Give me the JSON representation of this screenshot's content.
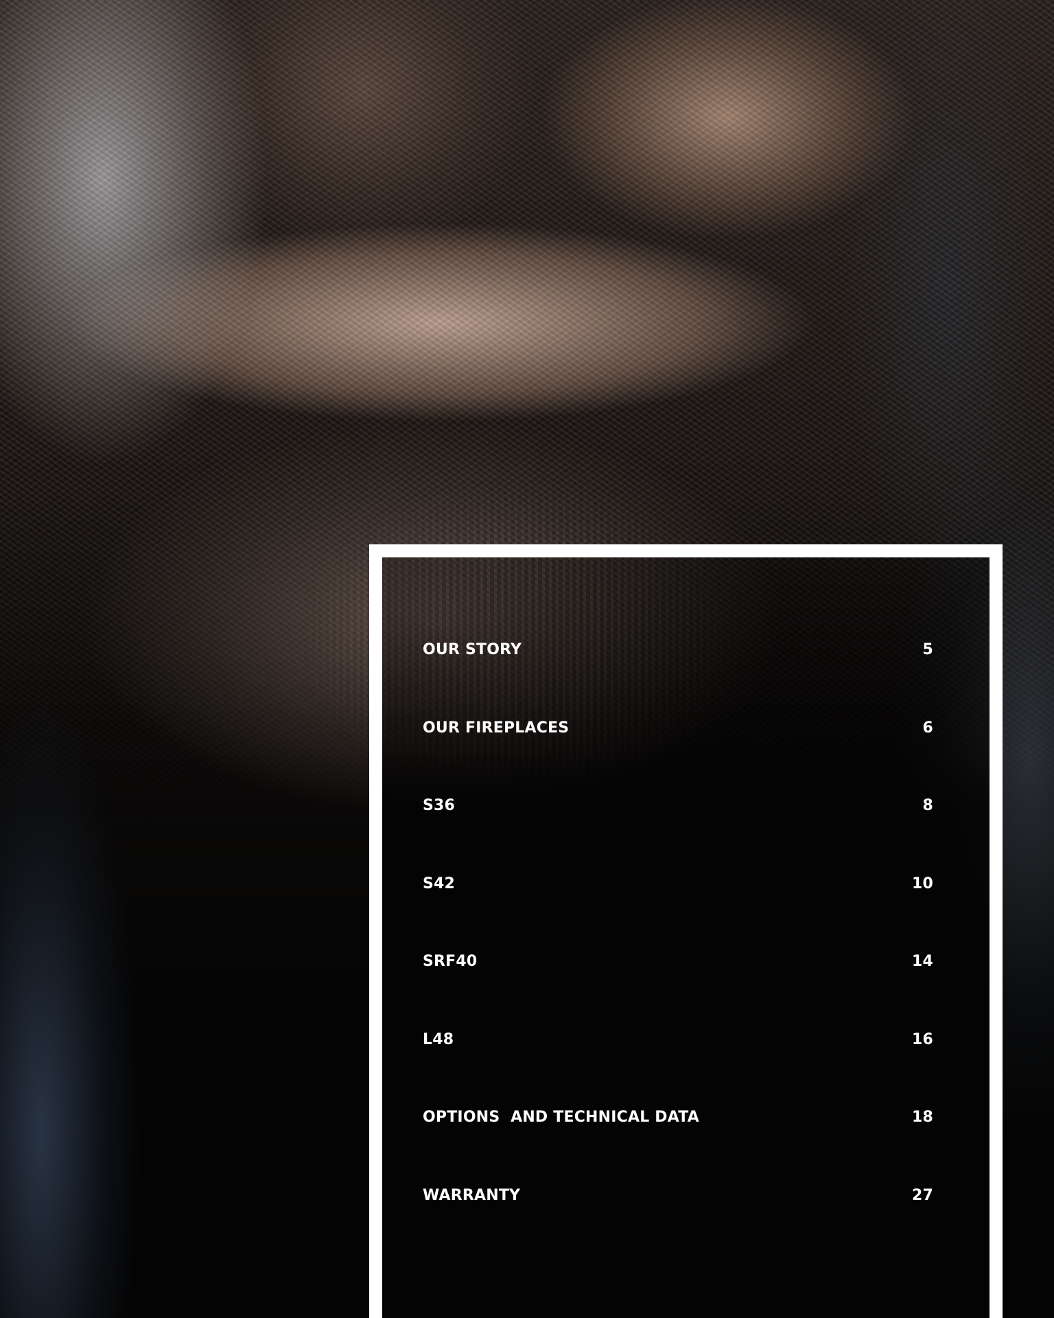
{
  "colors": {
    "frame": "#ffffff",
    "text": "#ffffff",
    "panel": "#050505"
  },
  "contents": [
    {
      "title": "OUR STORY",
      "page": "5"
    },
    {
      "title": "OUR FIREPLACES",
      "page": "6"
    },
    {
      "title": "S36",
      "page": "8"
    },
    {
      "title": "S42",
      "page": "10"
    },
    {
      "title": "SRF40",
      "page": "14"
    },
    {
      "title": "L48",
      "page": "16"
    },
    {
      "title": "OPTIONS  AND TECHNICAL DATA",
      "page": "18"
    },
    {
      "title": "WARRANTY",
      "page": "27"
    }
  ]
}
